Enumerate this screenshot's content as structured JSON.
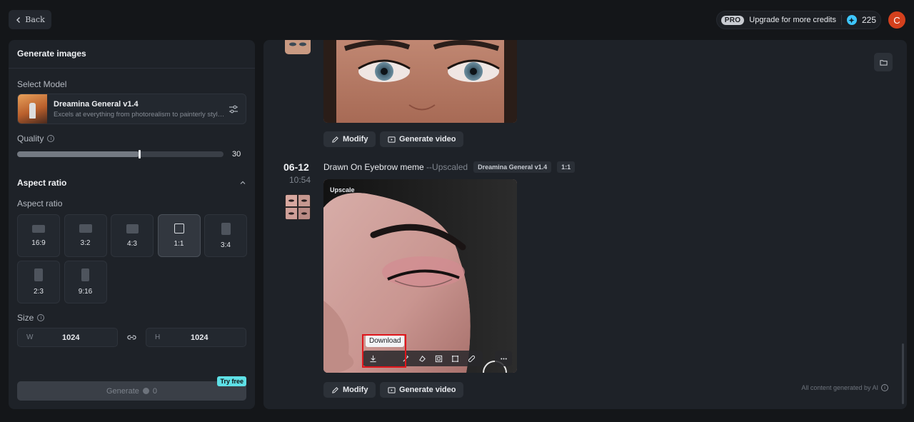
{
  "topbar": {
    "back_label": "Back",
    "pro_badge": "PRO",
    "upgrade_label": "Upgrade for more credits",
    "credits": "225",
    "avatar_initial": "C"
  },
  "left": {
    "title": "Generate images",
    "select_model_label": "Select Model",
    "model_name": "Dreamina General v1.4",
    "model_desc": "Excels at everything from photorealism to painterly style...",
    "quality_label": "Quality",
    "quality_fraction": 0.59,
    "quality_value": "30",
    "aspect_header": "Aspect ratio",
    "aspect_label": "Aspect ratio",
    "ratios": [
      {
        "label": "16:9"
      },
      {
        "label": "3:2"
      },
      {
        "label": "4:3"
      },
      {
        "label": "1:1",
        "active": true
      },
      {
        "label": "3:4"
      },
      {
        "label": "2:3"
      },
      {
        "label": "9:16"
      }
    ],
    "size_label": "Size",
    "width_prefix": "W",
    "width_value": "1024",
    "height_prefix": "H",
    "height_value": "1024",
    "generate_label": "Generate",
    "generate_cost": "0",
    "try_free": "Try free"
  },
  "main": {
    "modify_label": "Modify",
    "generate_video_label": "Generate video",
    "date": "06-12",
    "time": "10:54",
    "prompt": "Drawn On Eyebrow meme",
    "prompt_suffix": " --Upscaled",
    "model_tag": "Dreamina General v1.4",
    "ratio_tag": "1:1",
    "upscale_tag": "Upscale",
    "tooltip": "Download",
    "footer_note": "All content generated by AI"
  },
  "colors": {
    "accent_cyan": "#5ee0e6",
    "avatar_bg": "#d4401d",
    "highlight_red": "#e0161c"
  }
}
